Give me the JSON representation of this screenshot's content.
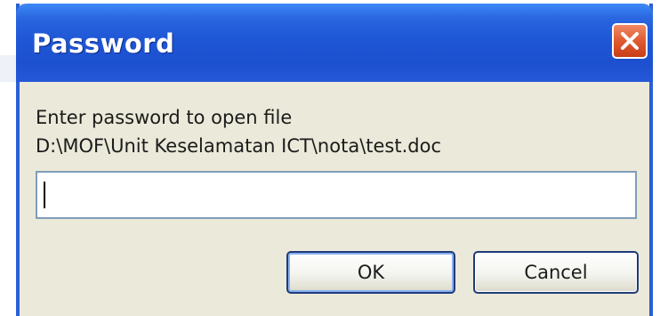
{
  "window": {
    "title": "Password",
    "close_icon": "close-icon"
  },
  "dialog": {
    "prompt": "Enter password to open file",
    "file_path": "D:\\MOF\\Unit Keselamatan ICT\\nota\\test.doc",
    "password_value": ""
  },
  "buttons": {
    "ok_label": "OK",
    "cancel_label": "Cancel"
  },
  "colors": {
    "titlebar": "#1f57d6",
    "close_button": "#e05a30",
    "dialog_background": "#ebe9d9",
    "input_border": "#7f9db9"
  }
}
